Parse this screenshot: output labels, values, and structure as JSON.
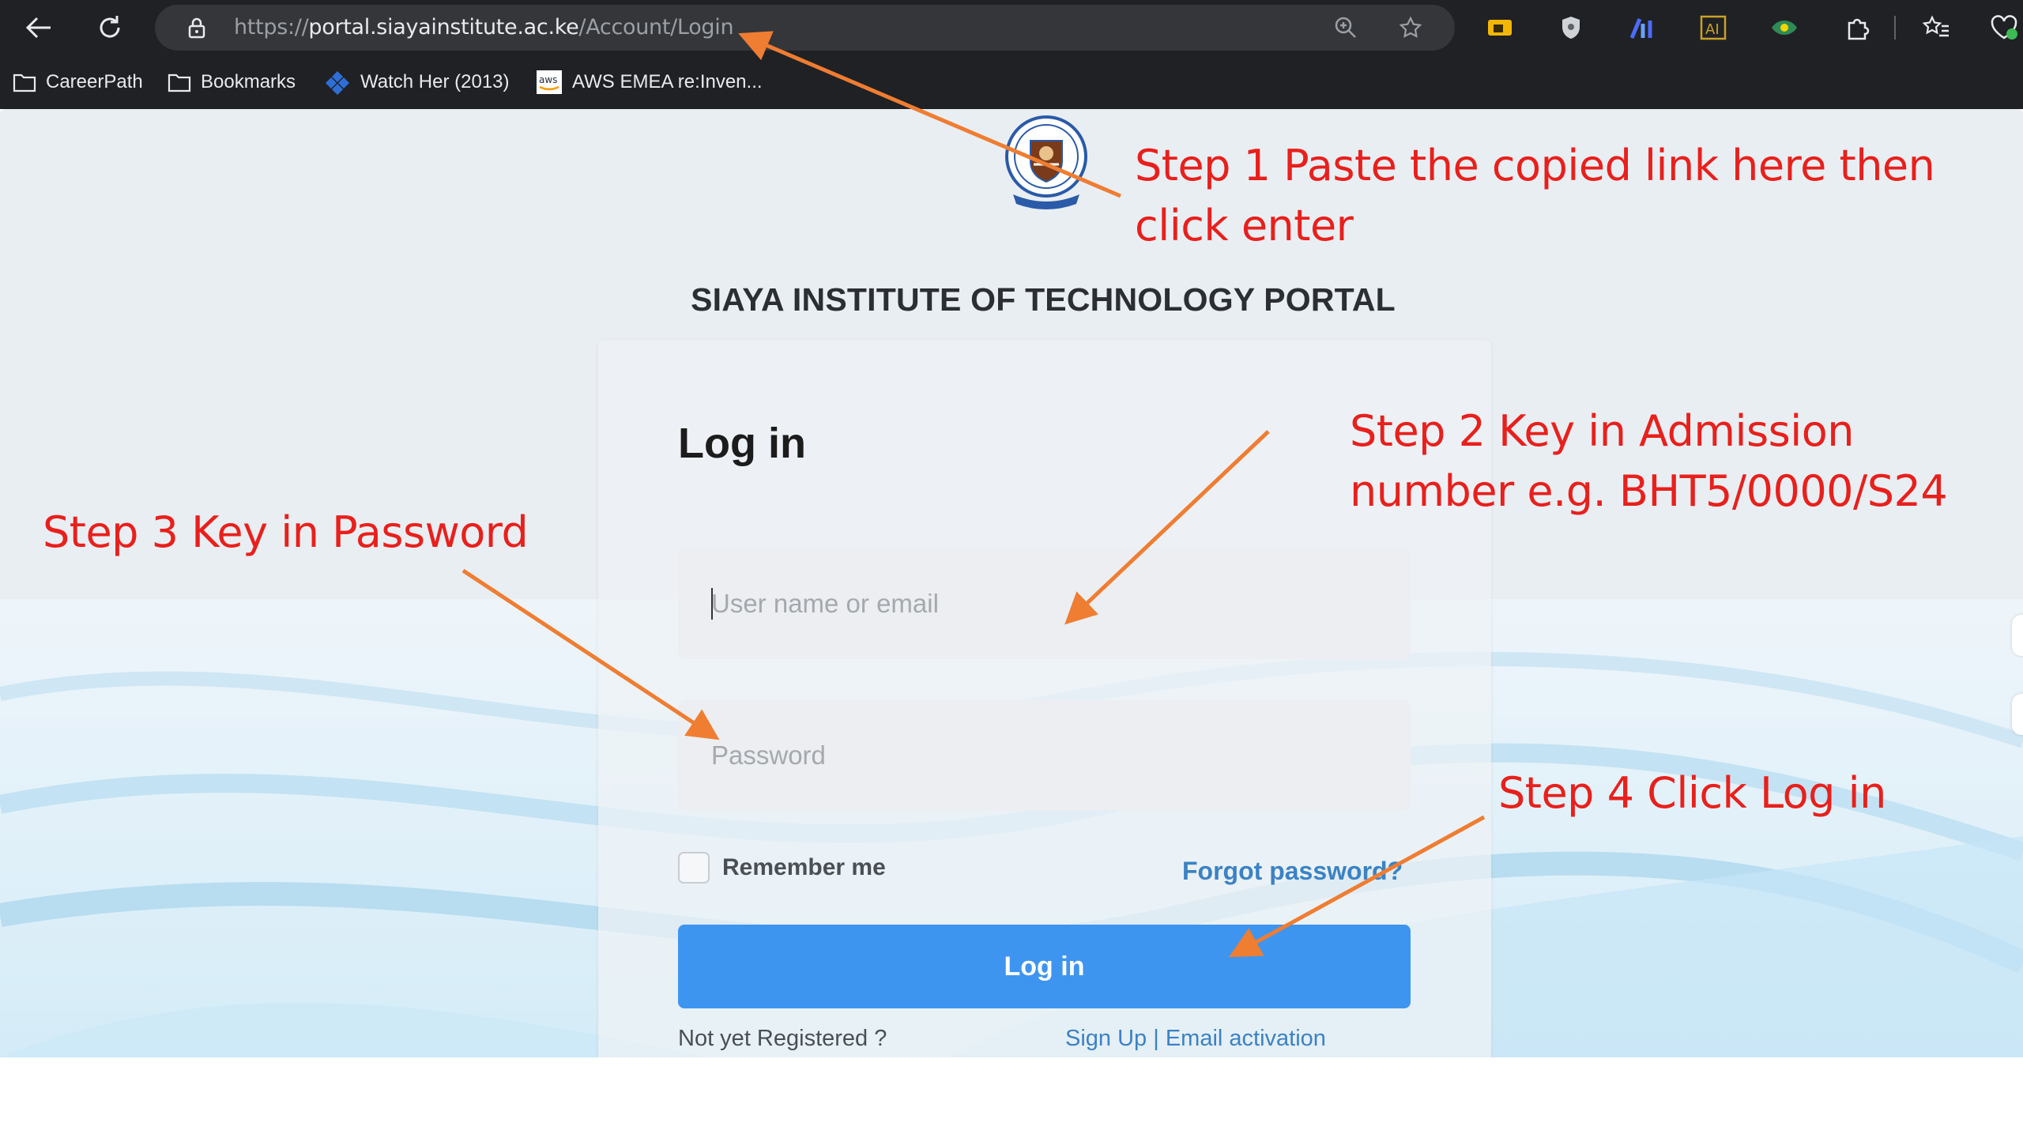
{
  "browser": {
    "url_scheme": "https://",
    "url_domain": "portal.siayainstitute.ac.ke",
    "url_path": "/Account/Login",
    "bookmarks": [
      "CareerPath",
      "Bookmarks",
      "Watch Her (2013)",
      "AWS EMEA re:Inven..."
    ]
  },
  "page": {
    "portal_title": "SIAYA INSTITUTE OF TECHNOLOGY PORTAL",
    "login_heading": "Log in",
    "username_placeholder": "User name or email",
    "password_placeholder": "Password",
    "remember_label": "Remember me",
    "forgot_label": "Forgot password?",
    "login_button": "Log in",
    "not_registered": "Not yet Registered ?",
    "signup_link": "Sign Up",
    "links_separator": " | ",
    "activation_link": "Email activation"
  },
  "annotations": {
    "step1_line1": "Step 1 Paste the copied link here then",
    "step1_line2": "click enter",
    "step2_line1": "Step 2 Key in Admission",
    "step2_line2": "number e.g. BHT5/0000/S24",
    "step3": "Step 3 Key in Password",
    "step4": "Step 4 Click Log in"
  },
  "colors": {
    "annotation_text": "#e8201c",
    "arrow": "#ef7d32",
    "login_button": "#3d95f0",
    "link": "#3b82c4"
  }
}
